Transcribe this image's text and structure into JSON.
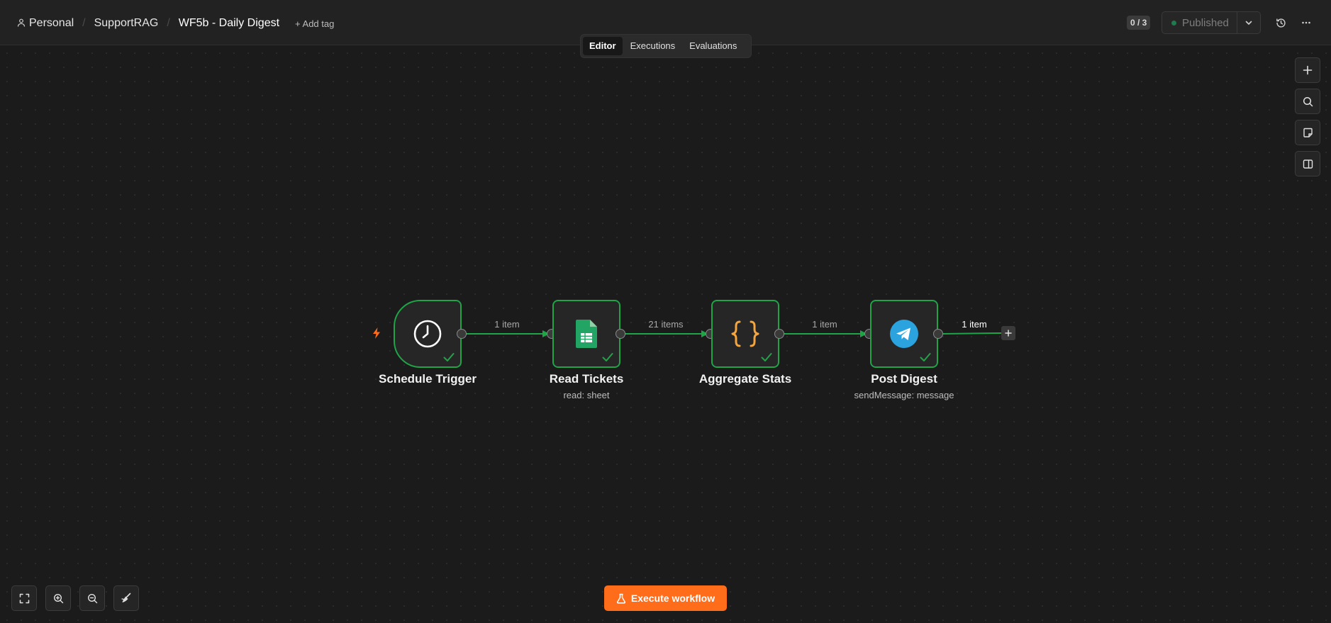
{
  "breadcrumb": {
    "project": "Personal",
    "folder": "SupportRAG",
    "workflow": "WF5b - Daily Digest",
    "add_tag": "+ Add tag"
  },
  "header": {
    "counter": "0 / 3",
    "status": "Published"
  },
  "tabs": [
    {
      "label": "Editor",
      "active": true
    },
    {
      "label": "Executions",
      "active": false
    },
    {
      "label": "Evaluations",
      "active": false
    }
  ],
  "nodes": [
    {
      "title": "Schedule Trigger",
      "subtitle": "",
      "icon": "clock-icon",
      "status": "success"
    },
    {
      "title": "Read Tickets",
      "subtitle": "read: sheet",
      "icon": "google-sheets-icon",
      "status": "success"
    },
    {
      "title": "Aggregate Stats",
      "subtitle": "",
      "icon": "code-braces-icon",
      "status": "success"
    },
    {
      "title": "Post Digest",
      "subtitle": "sendMessage: message",
      "icon": "telegram-icon",
      "status": "success"
    }
  ],
  "edges": [
    {
      "label": "1 item"
    },
    {
      "label": "21 items"
    },
    {
      "label": "1 item"
    },
    {
      "label": "1 item"
    }
  ],
  "actions": {
    "execute": "Execute workflow"
  },
  "colors": {
    "success": "#1fa447",
    "accent": "#ff6d1b",
    "trigger_bolt": "#ff6d1b",
    "sheets_green": "#21a464",
    "telegram_blue": "#2aa3df",
    "braces_orange": "#f5a540"
  }
}
